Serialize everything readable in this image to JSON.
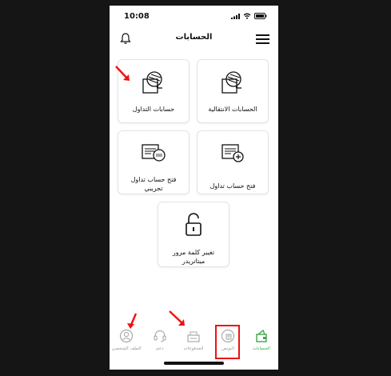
{
  "status_bar": {
    "time": "10:08"
  },
  "header": {
    "title": "الحسابات"
  },
  "cards": {
    "conversion_accounts": "الحسابات الانتقالية",
    "trading_accounts": "حسابات التداول",
    "open_trading_account": "فتح حساب تداول",
    "open_demo_account": "فتح حساب تداول تجريبي",
    "change_password": "تغيير كلمة مرور ميتاتريدر"
  },
  "nav": {
    "accounts": "الحسابات",
    "bonus": "البونص",
    "payments": "المدفوعات",
    "support": "دعم",
    "profile": "الملف الشخصي"
  },
  "colors": {
    "active_nav": "#3aa846",
    "highlight": "#ee1111",
    "background": "#151515"
  },
  "icons": [
    "bell-icon",
    "menu-icon",
    "wallet-icon",
    "file-add-icon",
    "demo-file-icon",
    "padlock-icon",
    "user-icon",
    "headset-icon",
    "payments-icon",
    "bonus-icon",
    "accounts-wallet-icon"
  ]
}
